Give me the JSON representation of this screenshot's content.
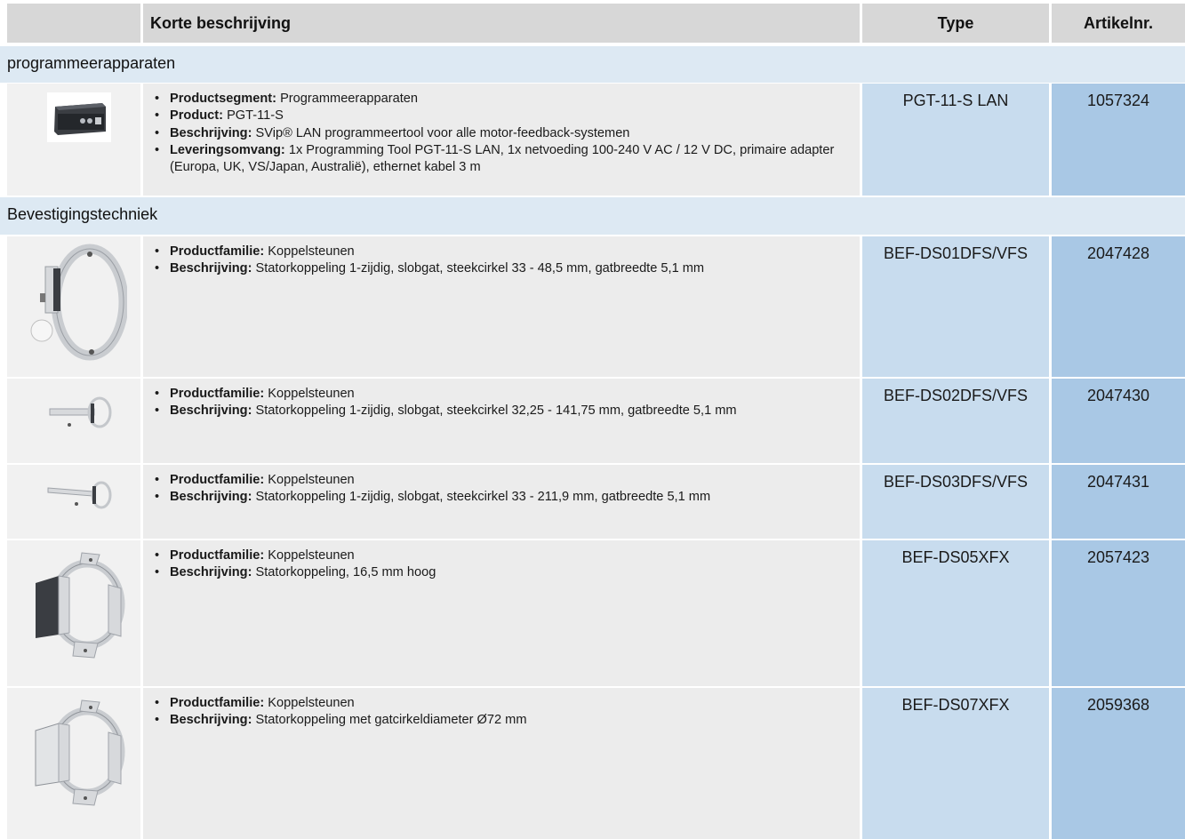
{
  "header": {
    "description": "Korte beschrijving",
    "type": "Type",
    "article": "Artikelnr."
  },
  "categories": {
    "programmers": "programmeerapparaten",
    "mounting": "Bevestigingstechniek"
  },
  "products": [
    {
      "image": "programming-tool-box",
      "bullets": [
        {
          "label": "Productsegment:",
          "text": "Programmeerapparaten"
        },
        {
          "label": "Product:",
          "text": "PGT-11-S"
        },
        {
          "label": "Beschrijving:",
          "text": "SVip® LAN programmeertool voor alle motor-feedback-systemen"
        },
        {
          "label": "Leveringsomvang:",
          "text": "1x Programming Tool PGT-11-S LAN, 1x netvoeding 100-240 V AC / 12 V DC, primaire adapter (Europa, UK, VS/Japan, Australië), ethernet kabel 3 m"
        }
      ],
      "type": "PGT-11-S LAN",
      "article": "1057324"
    },
    {
      "image": "stator-coupling-ring-bracket",
      "bullets": [
        {
          "label": "Productfamilie:",
          "text": "Koppelsteunen"
        },
        {
          "label": "Beschrijving:",
          "text": "Statorkoppeling 1-zijdig, slobgat, steekcirkel 33 - 48,5 mm, gatbreedte 5,1 mm"
        }
      ],
      "type": "BEF-DS01DFS/VFS",
      "article": "2047428"
    },
    {
      "image": "stator-coupling-arm",
      "bullets": [
        {
          "label": "Productfamilie:",
          "text": "Koppelsteunen"
        },
        {
          "label": "Beschrijving:",
          "text": "Statorkoppeling 1-zijdig, slobgat, steekcirkel 32,25 - 141,75 mm, gatbreedte 5,1 mm"
        }
      ],
      "type": "BEF-DS02DFS/VFS",
      "article": "2047430"
    },
    {
      "image": "stator-coupling-long-arm",
      "bullets": [
        {
          "label": "Productfamilie:",
          "text": "Koppelsteunen"
        },
        {
          "label": "Beschrijving:",
          "text": "Statorkoppeling 1-zijdig, slobgat, steekcirkel 33 - 211,9 mm, gatbreedte 5,1 mm"
        }
      ],
      "type": "BEF-DS03DFS/VFS",
      "article": "2047431"
    },
    {
      "image": "stator-coupling-bent-bracket",
      "bullets": [
        {
          "label": "Productfamilie:",
          "text": "Koppelsteunen"
        },
        {
          "label": "Beschrijving:",
          "text": "Statorkoppeling, 16,5 mm hoog"
        }
      ],
      "type": "BEF-DS05XFX",
      "article": "2057423"
    },
    {
      "image": "stator-coupling-bent-bracket",
      "bullets": [
        {
          "label": "Productfamilie:",
          "text": "Koppelsteunen"
        },
        {
          "label": "Beschrijving:",
          "text": "Statorkoppeling met gatcirkeldiameter Ø72 mm"
        }
      ],
      "type": "BEF-DS07XFX",
      "article": "2059368"
    }
  ]
}
